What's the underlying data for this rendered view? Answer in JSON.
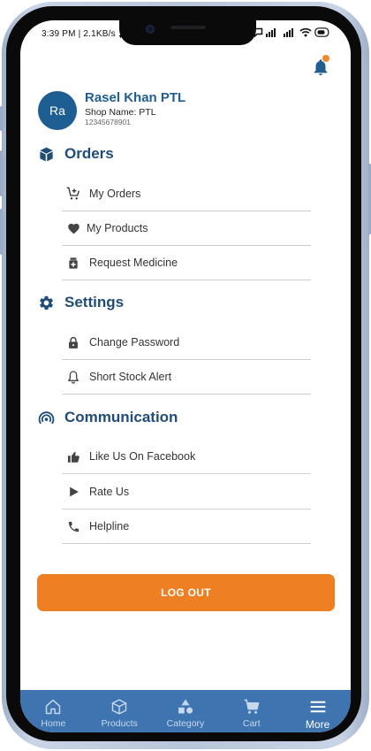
{
  "status_bar": {
    "time": "3:39 PM | 2.1KB/s"
  },
  "profile": {
    "avatar_initials": "Ra",
    "name": "Rasel Khan PTL",
    "shop": "Shop Name: PTL",
    "phone": "12345678901"
  },
  "sections": {
    "orders": {
      "title": "Orders",
      "icon": "box-icon",
      "items": [
        {
          "label": "My Orders",
          "icon": "cart-plus-icon"
        },
        {
          "label": "My Products",
          "icon": "heart-icon"
        },
        {
          "label": "Request Medicine",
          "icon": "medicine-icon"
        }
      ]
    },
    "settings": {
      "title": "Settings",
      "icon": "gear-icon",
      "items": [
        {
          "label": "Change Password",
          "icon": "lock-icon"
        },
        {
          "label": "Short Stock Alert",
          "icon": "bell-outline-icon"
        }
      ]
    },
    "communication": {
      "title": "Communication",
      "icon": "broadcast-icon",
      "items": [
        {
          "label": "Like Us On Facebook",
          "icon": "thumbs-up-icon"
        },
        {
          "label": "Rate Us",
          "icon": "play-icon"
        },
        {
          "label": "Helpline",
          "icon": "phone-icon"
        }
      ]
    }
  },
  "logout_label": "LOG OUT",
  "bottom_nav": [
    {
      "label": "Home",
      "icon": "home-icon",
      "active": false
    },
    {
      "label": "Products",
      "icon": "cube-icon",
      "active": false
    },
    {
      "label": "Category",
      "icon": "shapes-icon",
      "active": false
    },
    {
      "label": "Cart",
      "icon": "cart-icon",
      "active": false
    },
    {
      "label": "More",
      "icon": "menu-icon",
      "active": true
    }
  ],
  "colors": {
    "primary": "#1f5e93",
    "heading": "#1f4d78",
    "accent": "#ee8023",
    "nav_bg": "#3e75b0",
    "notification_dot": "#ee8c2b"
  }
}
